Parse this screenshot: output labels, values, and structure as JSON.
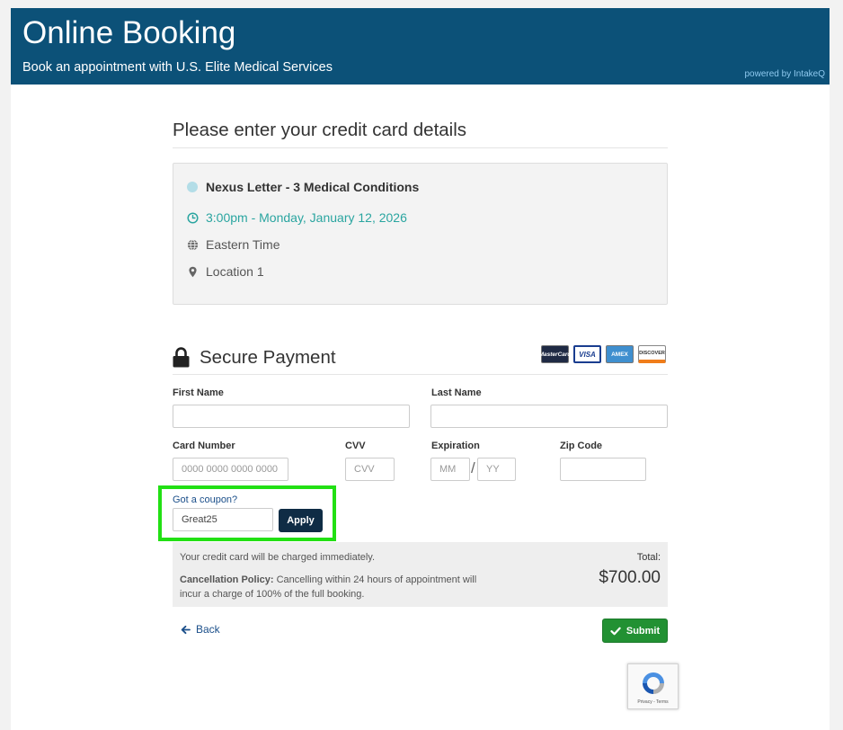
{
  "header": {
    "title": "Online Booking",
    "subtitle": "Book an appointment with U.S. Elite Medical Services",
    "powered_by": "powered by IntakeQ",
    "background_color": "#0c5178"
  },
  "main": {
    "heading": "Please enter your credit card details",
    "summary": {
      "service": "Nexus Letter - 3 Medical Conditions",
      "datetime": "3:00pm - Monday, January 12, 2026",
      "timezone": "Eastern Time",
      "location": "Location 1",
      "service_dot_color": "#b3dde7",
      "time_color": "#2aa5a0"
    },
    "payment": {
      "title": "Secure Payment",
      "card_brands": [
        "MasterCard",
        "VISA",
        "AMEX",
        "DISCOVER"
      ],
      "first_name_label": "First Name",
      "first_name_value": "",
      "last_name_label": "Last Name",
      "last_name_value": "",
      "card_number_label": "Card Number",
      "card_number_placeholder": "0000 0000 0000 0000",
      "cvv_label": "CVV",
      "cvv_placeholder": "CVV",
      "expiration_label": "Expiration",
      "exp_month_placeholder": "MM",
      "exp_separator": "/",
      "exp_year_placeholder": "YY",
      "zip_label": "Zip Code",
      "zip_value": ""
    },
    "coupon": {
      "link_label": "Got a coupon?",
      "value": "Great25",
      "apply_label": "Apply",
      "highlight_color": "#22e014"
    },
    "totals": {
      "charge_note": "Your credit card will be charged immediately.",
      "policy_label": "Cancellation Policy:",
      "policy_text": "Cancelling within 24 hours of appointment will incur a charge of 100% of the full booking.",
      "total_label": "Total:",
      "total_value": "$700.00"
    },
    "actions": {
      "back_label": "Back",
      "submit_label": "Submit",
      "submit_color": "#229133"
    },
    "recaptcha": {
      "links": "Privacy - Terms"
    }
  }
}
